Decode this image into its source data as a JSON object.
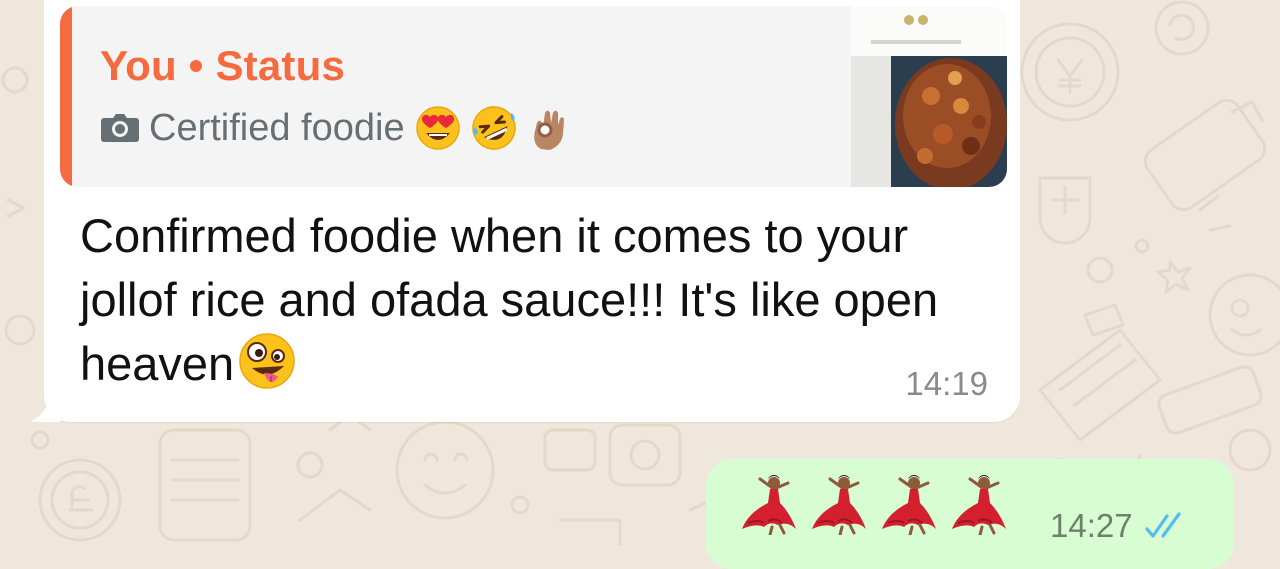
{
  "incoming_message": {
    "quoted_status": {
      "author": "You • Status",
      "caption": "Certified foodie",
      "caption_icon": "camera-icon",
      "caption_emojis": [
        "heart-eyes-emoji",
        "rolling-laughing-emoji",
        "ok-hand-emoji"
      ],
      "thumbnail": "jollof-rice-photo-thumbnail"
    },
    "text": "Confirmed foodie when it comes to your jollof rice and ofada sauce!!! It's like open heaven",
    "trailing_emoji": "zany-face-emoji",
    "time": "14:19"
  },
  "outgoing_message": {
    "emojis": [
      "dancing-woman-emoji",
      "dancing-woman-emoji",
      "dancing-woman-emoji",
      "dancing-woman-emoji"
    ],
    "time": "14:27",
    "status": "read",
    "status_icon": "double-check-icon"
  },
  "colors": {
    "wallpaper": "#efe7dc",
    "incoming_bubble": "#ffffff",
    "outgoing_bubble": "#d9fdd3",
    "quote_accent": "#f56a3f",
    "read_ticks": "#53bdeb"
  }
}
